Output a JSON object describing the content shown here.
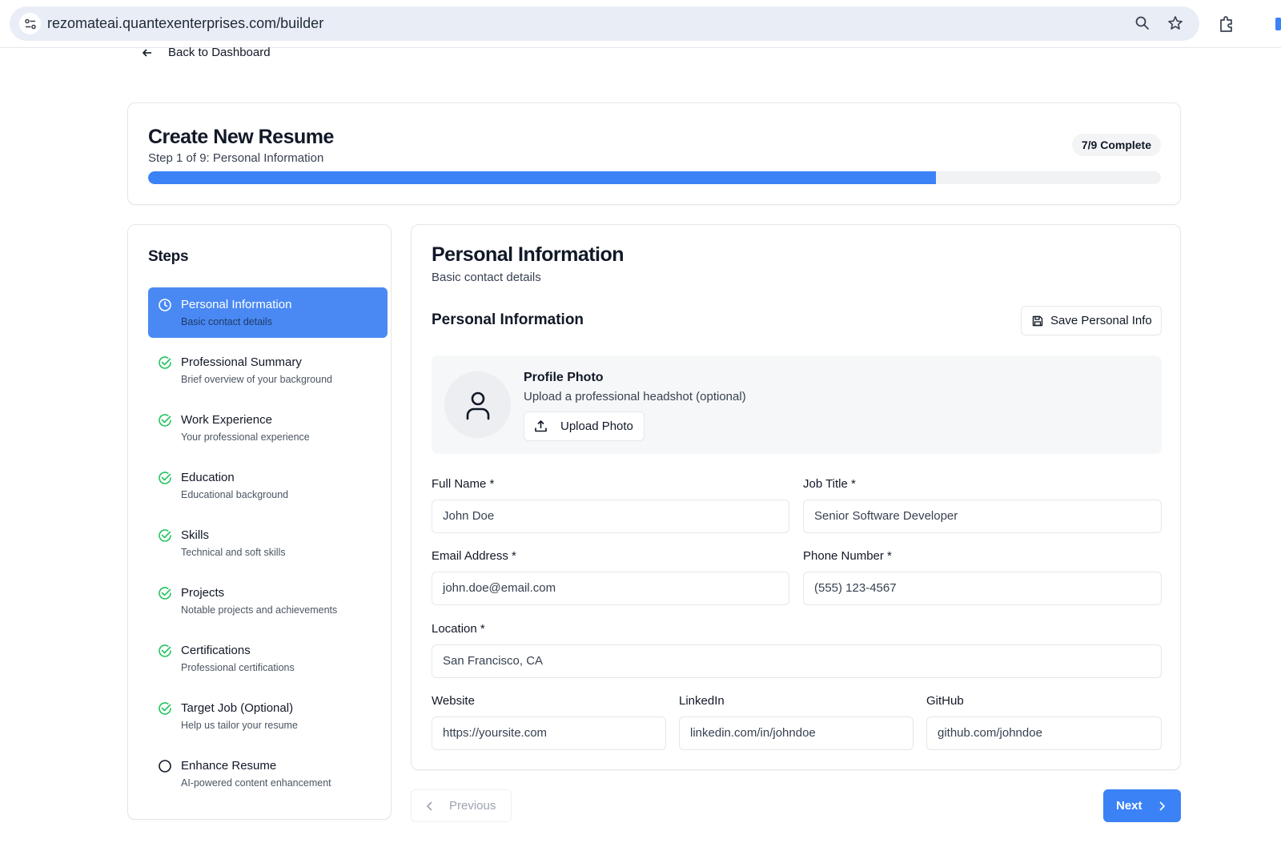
{
  "browser": {
    "url": "rezomateai.quantexenterprises.com/builder"
  },
  "nav": {
    "back_label": "Back to Dashboard"
  },
  "header": {
    "title": "Create New Resume",
    "subtitle": "Step 1 of 9: Personal Information",
    "complete_badge": "7/9 Complete",
    "progress_fraction": 0.778,
    "accent_color": "#3b82f6"
  },
  "steps": {
    "title": "Steps",
    "items": [
      {
        "label": "Personal Information",
        "desc": "Basic contact details",
        "status": "active",
        "icon": "clock-icon"
      },
      {
        "label": "Professional Summary",
        "desc": "Brief overview of your background",
        "status": "complete",
        "icon": "check-circle-icon"
      },
      {
        "label": "Work Experience",
        "desc": "Your professional experience",
        "status": "complete",
        "icon": "check-circle-icon"
      },
      {
        "label": "Education",
        "desc": "Educational background",
        "status": "complete",
        "icon": "check-circle-icon"
      },
      {
        "label": "Skills",
        "desc": "Technical and soft skills",
        "status": "complete",
        "icon": "check-circle-icon"
      },
      {
        "label": "Projects",
        "desc": "Notable projects and achievements",
        "status": "complete",
        "icon": "check-circle-icon"
      },
      {
        "label": "Certifications",
        "desc": "Professional certifications",
        "status": "complete",
        "icon": "check-circle-icon"
      },
      {
        "label": "Target Job (Optional)",
        "desc": "Help us tailor your resume",
        "status": "complete",
        "icon": "check-circle-icon"
      },
      {
        "label": "Enhance Resume",
        "desc": "AI-powered content enhancement",
        "status": "pending",
        "icon": "circle-icon"
      }
    ]
  },
  "main": {
    "title": "Personal Information",
    "subtitle": "Basic contact details",
    "section_title": "Personal Information",
    "save_label": "Save Personal Info",
    "photo": {
      "title": "Profile Photo",
      "subtitle": "Upload a professional headshot (optional)",
      "upload_label": "Upload Photo"
    },
    "fields": {
      "full_name": {
        "label": "Full Name *",
        "value": "John Doe"
      },
      "job_title": {
        "label": "Job Title *",
        "value": "Senior Software Developer"
      },
      "email": {
        "label": "Email Address *",
        "value": "john.doe@email.com"
      },
      "phone": {
        "label": "Phone Number *",
        "value": "(555) 123-4567"
      },
      "location": {
        "label": "Location *",
        "value": "San Francisco, CA"
      },
      "website": {
        "label": "Website",
        "value": "https://yoursite.com"
      },
      "linkedin": {
        "label": "LinkedIn",
        "value": "linkedin.com/in/johndoe"
      },
      "github": {
        "label": "GitHub",
        "value": "github.com/johndoe"
      }
    }
  },
  "footer": {
    "previous_label": "Previous",
    "next_label": "Next"
  }
}
